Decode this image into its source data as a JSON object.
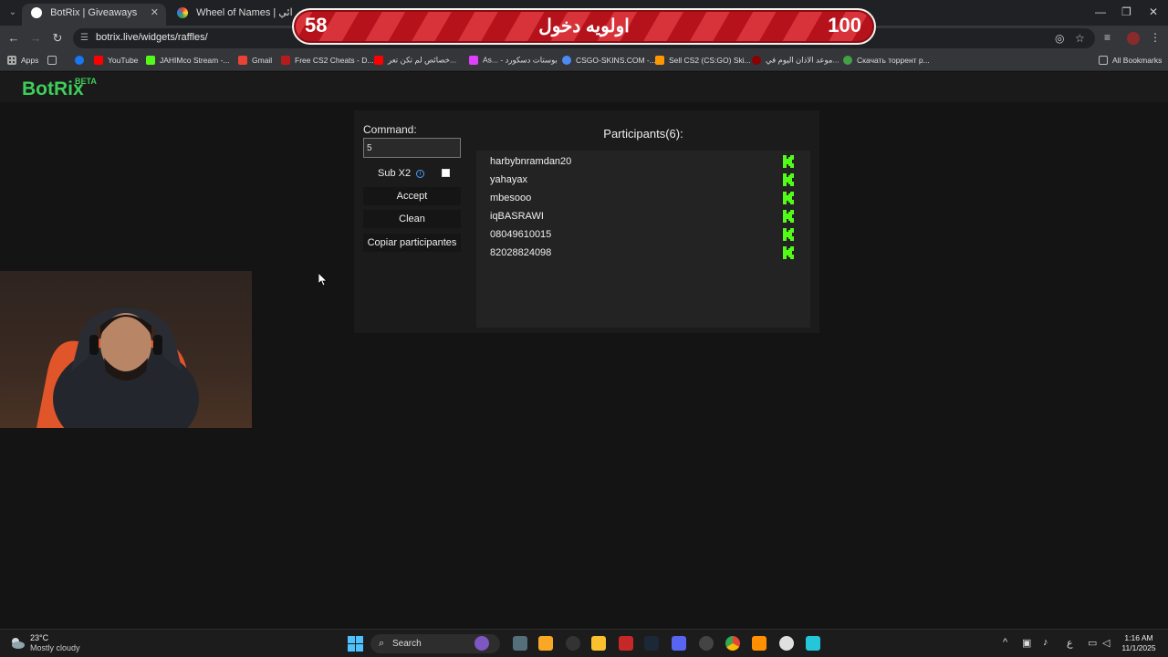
{
  "browser": {
    "tabs": [
      {
        "label": "BotRix | Giveaways",
        "active": true
      },
      {
        "label": "Wheel of Names | اسم العشوائي",
        "active": false
      }
    ],
    "url": "botrix.live/widgets/raffles/",
    "bookmarks": [
      "Apps",
      "YouTube",
      "JAHIMco Stream -...",
      "Gmail",
      "Free CS2 Cheats - D...",
      "خصائص لم تكن تعر...",
      "As... - بوستات دسكورد",
      "CSGO-SKINS.COM -...",
      "Sell CS2 (CS:GO) Ski...",
      "موعد الاذان اليوم في...",
      "Скачать торрент р...",
      "All Bookmarks"
    ]
  },
  "overlay": {
    "left_number": "58",
    "title": "اولويه دخول",
    "right_number": "100"
  },
  "app": {
    "logo": "BotRix",
    "badge": "BETA",
    "command_label": "Command:",
    "command_value": "5",
    "sub_label": "Sub X2",
    "sub_info_glyph": "i",
    "sub_checked": false,
    "accept_label": "Accept",
    "clean_label": "Clean",
    "copy_label": "Copiar participantes",
    "participants_title": "Participants(6):",
    "participants": [
      "harbybnramdan20",
      "yahayax",
      "mbesooo",
      "iqBASRAWI",
      "08049610015",
      "82028824098"
    ],
    "platform_icon": "kick-icon",
    "accent": "#3ecf5a"
  },
  "taskbar": {
    "temperature": "23°C",
    "weather": "Mostly cloudy",
    "search_label": "Search",
    "language": "ع",
    "time": "1:16 AM",
    "date": "11/1/2025"
  }
}
